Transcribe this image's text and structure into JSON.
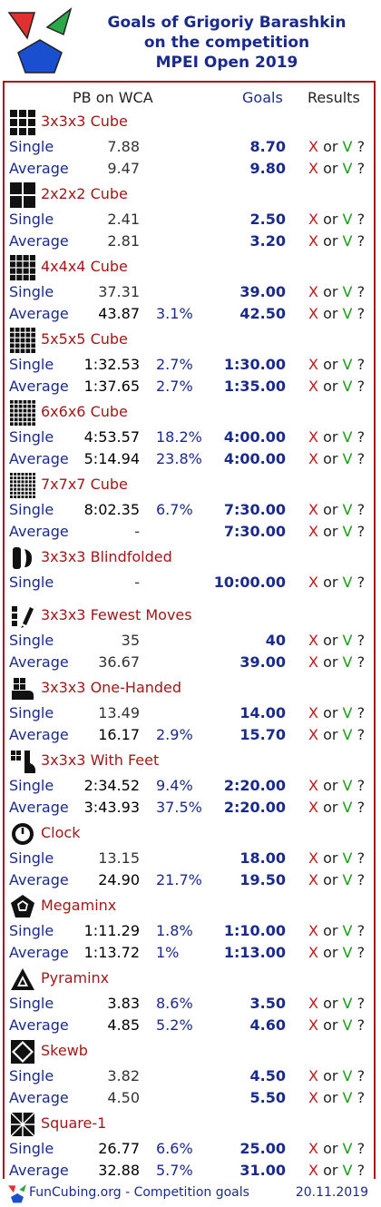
{
  "header": {
    "title_lines": [
      "Goals of Grigoriy Barashkin",
      "on the competition",
      "MPEI Open 2019"
    ]
  },
  "columns": {
    "pb": "PB on WCA",
    "goals": "Goals",
    "results": "Results"
  },
  "result_tokens": {
    "x": "X",
    "or": "or",
    "v": "V",
    "q": "?"
  },
  "colors": {
    "title": "#1a2a8c",
    "event": "#a01818",
    "x": "#c01818",
    "v": "#1a9c1a"
  },
  "events": [
    {
      "name": "3x3x3 Cube",
      "icon": "grid-3-icon",
      "rows": [
        {
          "label": "Single",
          "pb": "7.88",
          "pct": "",
          "goal": "8.70"
        },
        {
          "label": "Average",
          "pb": "9.47",
          "pct": "",
          "goal": "9.80"
        }
      ]
    },
    {
      "name": "2x2x2 Cube",
      "icon": "grid-2-icon",
      "rows": [
        {
          "label": "Single",
          "pb": "2.41",
          "pct": "",
          "goal": "2.50"
        },
        {
          "label": "Average",
          "pb": "2.81",
          "pct": "",
          "goal": "3.20"
        }
      ]
    },
    {
      "name": "4x4x4 Cube",
      "icon": "grid-4-icon",
      "rows": [
        {
          "label": "Single",
          "pb": "37.31",
          "pct": "",
          "goal": "39.00"
        },
        {
          "label": "Average",
          "pb": "43.87",
          "pct": "3.1%",
          "goal": "42.50"
        }
      ]
    },
    {
      "name": "5x5x5 Cube",
      "icon": "grid-5-icon",
      "rows": [
        {
          "label": "Single",
          "pb": "1:32.53",
          "pct": "2.7%",
          "goal": "1:30.00"
        },
        {
          "label": "Average",
          "pb": "1:37.65",
          "pct": "2.7%",
          "goal": "1:35.00"
        }
      ]
    },
    {
      "name": "6x6x6 Cube",
      "icon": "grid-6-icon",
      "rows": [
        {
          "label": "Single",
          "pb": "4:53.57",
          "pct": "18.2%",
          "goal": "4:00.00"
        },
        {
          "label": "Average",
          "pb": "5:14.94",
          "pct": "23.8%",
          "goal": "4:00.00"
        }
      ]
    },
    {
      "name": "7x7x7 Cube",
      "icon": "grid-7-icon",
      "rows": [
        {
          "label": "Single",
          "pb": "8:02.35",
          "pct": "6.7%",
          "goal": "7:30.00"
        },
        {
          "label": "Average",
          "pb": "-",
          "pct": "",
          "goal": "7:30.00"
        }
      ]
    },
    {
      "name": "3x3x3 Blindfolded",
      "icon": "blindfold-icon",
      "rows": [
        {
          "label": "Single",
          "pb": "-",
          "pct": "",
          "goal": "10:00.00"
        }
      ]
    },
    {
      "name": "3x3x3 Fewest Moves",
      "icon": "pencil-icon",
      "rows": [
        {
          "label": "Single",
          "pb": "35",
          "pct": "",
          "goal": "40"
        },
        {
          "label": "Average",
          "pb": "36.67",
          "pct": "",
          "goal": "39.00"
        }
      ]
    },
    {
      "name": "3x3x3 One-Handed",
      "icon": "hand-icon",
      "rows": [
        {
          "label": "Single",
          "pb": "13.49",
          "pct": "",
          "goal": "14.00"
        },
        {
          "label": "Average",
          "pb": "16.17",
          "pct": "2.9%",
          "goal": "15.70"
        }
      ]
    },
    {
      "name": "3x3x3 With Feet",
      "icon": "foot-icon",
      "rows": [
        {
          "label": "Single",
          "pb": "2:34.52",
          "pct": "9.4%",
          "goal": "2:20.00"
        },
        {
          "label": "Average",
          "pb": "3:43.93",
          "pct": "37.5%",
          "goal": "2:20.00"
        }
      ]
    },
    {
      "name": "Clock",
      "icon": "clock-icon",
      "rows": [
        {
          "label": "Single",
          "pb": "13.15",
          "pct": "",
          "goal": "18.00"
        },
        {
          "label": "Average",
          "pb": "24.90",
          "pct": "21.7%",
          "goal": "19.50"
        }
      ]
    },
    {
      "name": "Megaminx",
      "icon": "megaminx-icon",
      "rows": [
        {
          "label": "Single",
          "pb": "1:11.29",
          "pct": "1.8%",
          "goal": "1:10.00"
        },
        {
          "label": "Average",
          "pb": "1:13.72",
          "pct": "1%",
          "goal": "1:13.00"
        }
      ]
    },
    {
      "name": "Pyraminx",
      "icon": "pyraminx-icon",
      "rows": [
        {
          "label": "Single",
          "pb": "3.83",
          "pct": "8.6%",
          "goal": "3.50"
        },
        {
          "label": "Average",
          "pb": "4.85",
          "pct": "5.2%",
          "goal": "4.60"
        }
      ]
    },
    {
      "name": "Skewb",
      "icon": "skewb-icon",
      "rows": [
        {
          "label": "Single",
          "pb": "3.82",
          "pct": "",
          "goal": "4.50"
        },
        {
          "label": "Average",
          "pb": "4.50",
          "pct": "",
          "goal": "5.50"
        }
      ]
    },
    {
      "name": "Square-1",
      "icon": "square1-icon",
      "rows": [
        {
          "label": "Single",
          "pb": "26.77",
          "pct": "6.6%",
          "goal": "25.00"
        },
        {
          "label": "Average",
          "pb": "32.88",
          "pct": "5.7%",
          "goal": "31.00"
        }
      ]
    }
  ],
  "footer": {
    "site": "FunCubing.org - Competition goals",
    "date": "20.11.2019"
  }
}
